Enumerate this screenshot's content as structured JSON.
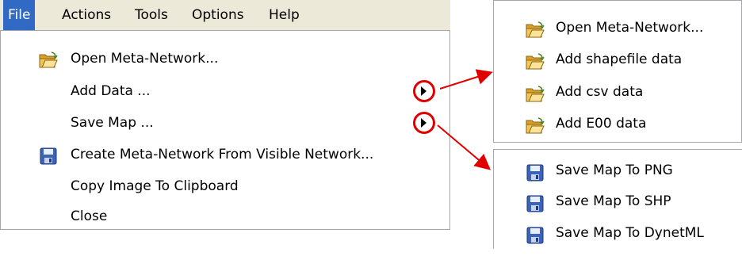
{
  "menubar": {
    "items": [
      {
        "label": "File",
        "active": true
      },
      {
        "label": "Actions"
      },
      {
        "label": "Tools"
      },
      {
        "label": "Options"
      },
      {
        "label": "Help"
      }
    ]
  },
  "file_menu": {
    "items": [
      {
        "label": "Open Meta-Network...",
        "icon": "folder-open-icon"
      },
      {
        "label": "Add Data ...",
        "submenu": true
      },
      {
        "label": "Save Map ...",
        "submenu": true
      },
      {
        "label": "Create Meta-Network From Visible Network...",
        "icon": "floppy-disk-icon"
      },
      {
        "label": "Copy Image To Clipboard"
      },
      {
        "label": "Close"
      }
    ]
  },
  "add_data_submenu": {
    "items": [
      {
        "label": "Open Meta-Network...",
        "icon": "folder-open-icon"
      },
      {
        "label": "Add shapefile data",
        "icon": "folder-open-icon"
      },
      {
        "label": "Add csv data",
        "icon": "folder-open-icon"
      },
      {
        "label": "Add E00 data",
        "icon": "folder-open-icon"
      }
    ]
  },
  "save_map_submenu": {
    "items": [
      {
        "label": "Save Map To PNG",
        "icon": "floppy-disk-icon"
      },
      {
        "label": "Save Map To SHP",
        "icon": "floppy-disk-icon"
      },
      {
        "label": "Save Map To DynetML",
        "icon": "floppy-disk-icon"
      }
    ]
  },
  "colors": {
    "menubar_bg": "#ece9d8",
    "highlight": "#316ac5",
    "annotation_red": "#e00000"
  }
}
